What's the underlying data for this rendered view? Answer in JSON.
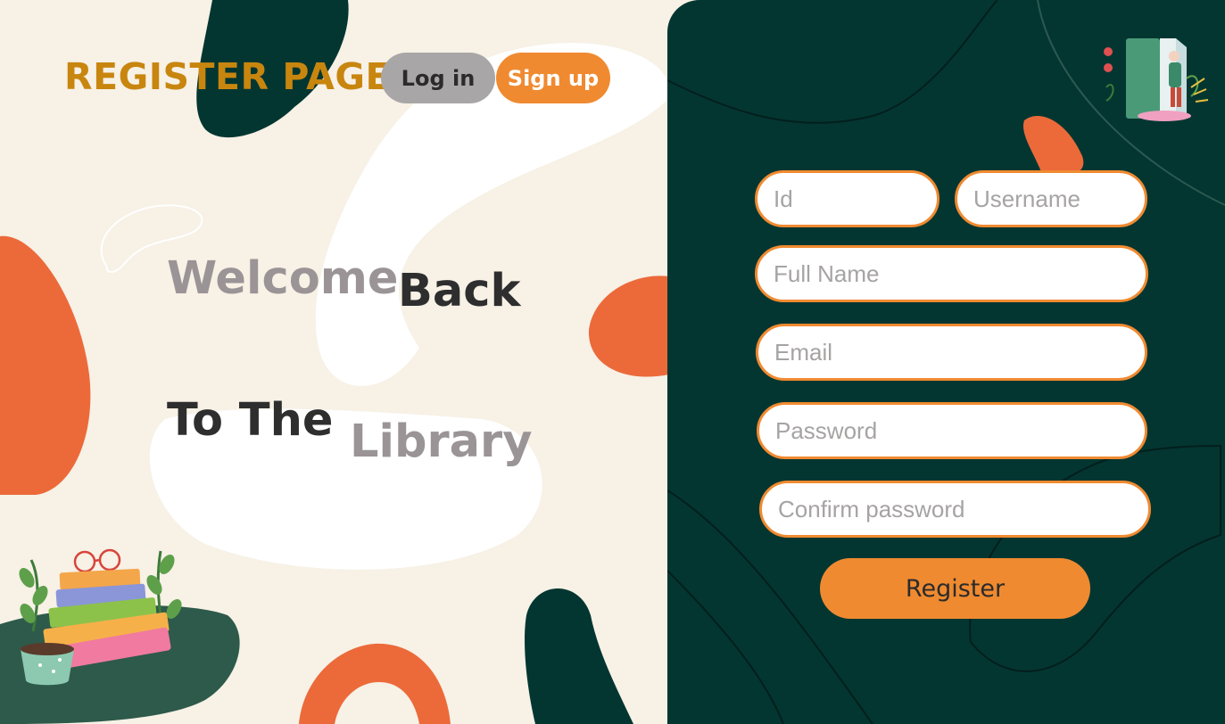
{
  "header": {
    "title": "REGISTER PAGE",
    "login_label": "Log in",
    "signup_label": "Sign up"
  },
  "hero": {
    "word1": "Welcome",
    "word2": "Back",
    "word3": "To The",
    "word4": "Library"
  },
  "form": {
    "id_placeholder": "Id",
    "username_placeholder": "Username",
    "fullname_placeholder": "Full Name",
    "email_placeholder": "Email",
    "password_placeholder": "Password",
    "confirm_placeholder": "Confirm password",
    "register_label": "Register"
  },
  "colors": {
    "title": "#c8860f",
    "accent_orange": "#f08a30",
    "blob_orange": "#ec6a3a",
    "dark_green": "#043631",
    "cream": "#f7f1e6",
    "login_grey": "#a8a6a6",
    "text_dark": "#2e2e2e",
    "text_grey": "#9a9496"
  },
  "icons": {
    "book_stack": "book-stack-illustration",
    "reading_book": "open-book-reader-illustration"
  }
}
